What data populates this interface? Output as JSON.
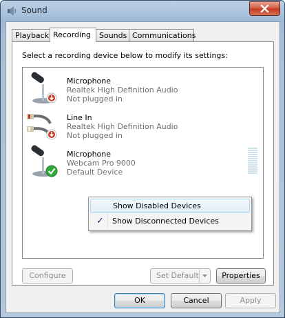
{
  "window": {
    "title": "Sound",
    "icon": "speaker-icon",
    "close_icon": "close-icon"
  },
  "tabs": [
    {
      "label": "Playback",
      "active": false
    },
    {
      "label": "Recording",
      "active": true
    },
    {
      "label": "Sounds",
      "active": false
    },
    {
      "label": "Communications",
      "active": false
    }
  ],
  "instructions": "Select a recording device below to modify its settings:",
  "devices": [
    {
      "name": "Microphone",
      "driver": "Realtek High Definition Audio",
      "status": "Not plugged in",
      "icon": "microphone-disconnected-icon"
    },
    {
      "name": "Line In",
      "driver": "Realtek High Definition Audio",
      "status": "Not plugged in",
      "icon": "line-in-disconnected-icon"
    },
    {
      "name": "Microphone",
      "driver": "Webcam Pro 9000",
      "status": "Default Device",
      "icon": "microphone-default-icon"
    }
  ],
  "context_menu": {
    "items": [
      {
        "label": "Show Disabled Devices",
        "checked": false
      },
      {
        "label": "Show Disconnected Devices",
        "checked": true
      }
    ]
  },
  "buttons": {
    "configure": "Configure",
    "set_default": "Set Default",
    "properties": "Properties",
    "ok": "OK",
    "cancel": "Cancel",
    "apply": "Apply"
  },
  "colors": {
    "accent": "#3c7fb1",
    "default_check": "#2eaa3a",
    "unplugged": "#c0392b"
  }
}
